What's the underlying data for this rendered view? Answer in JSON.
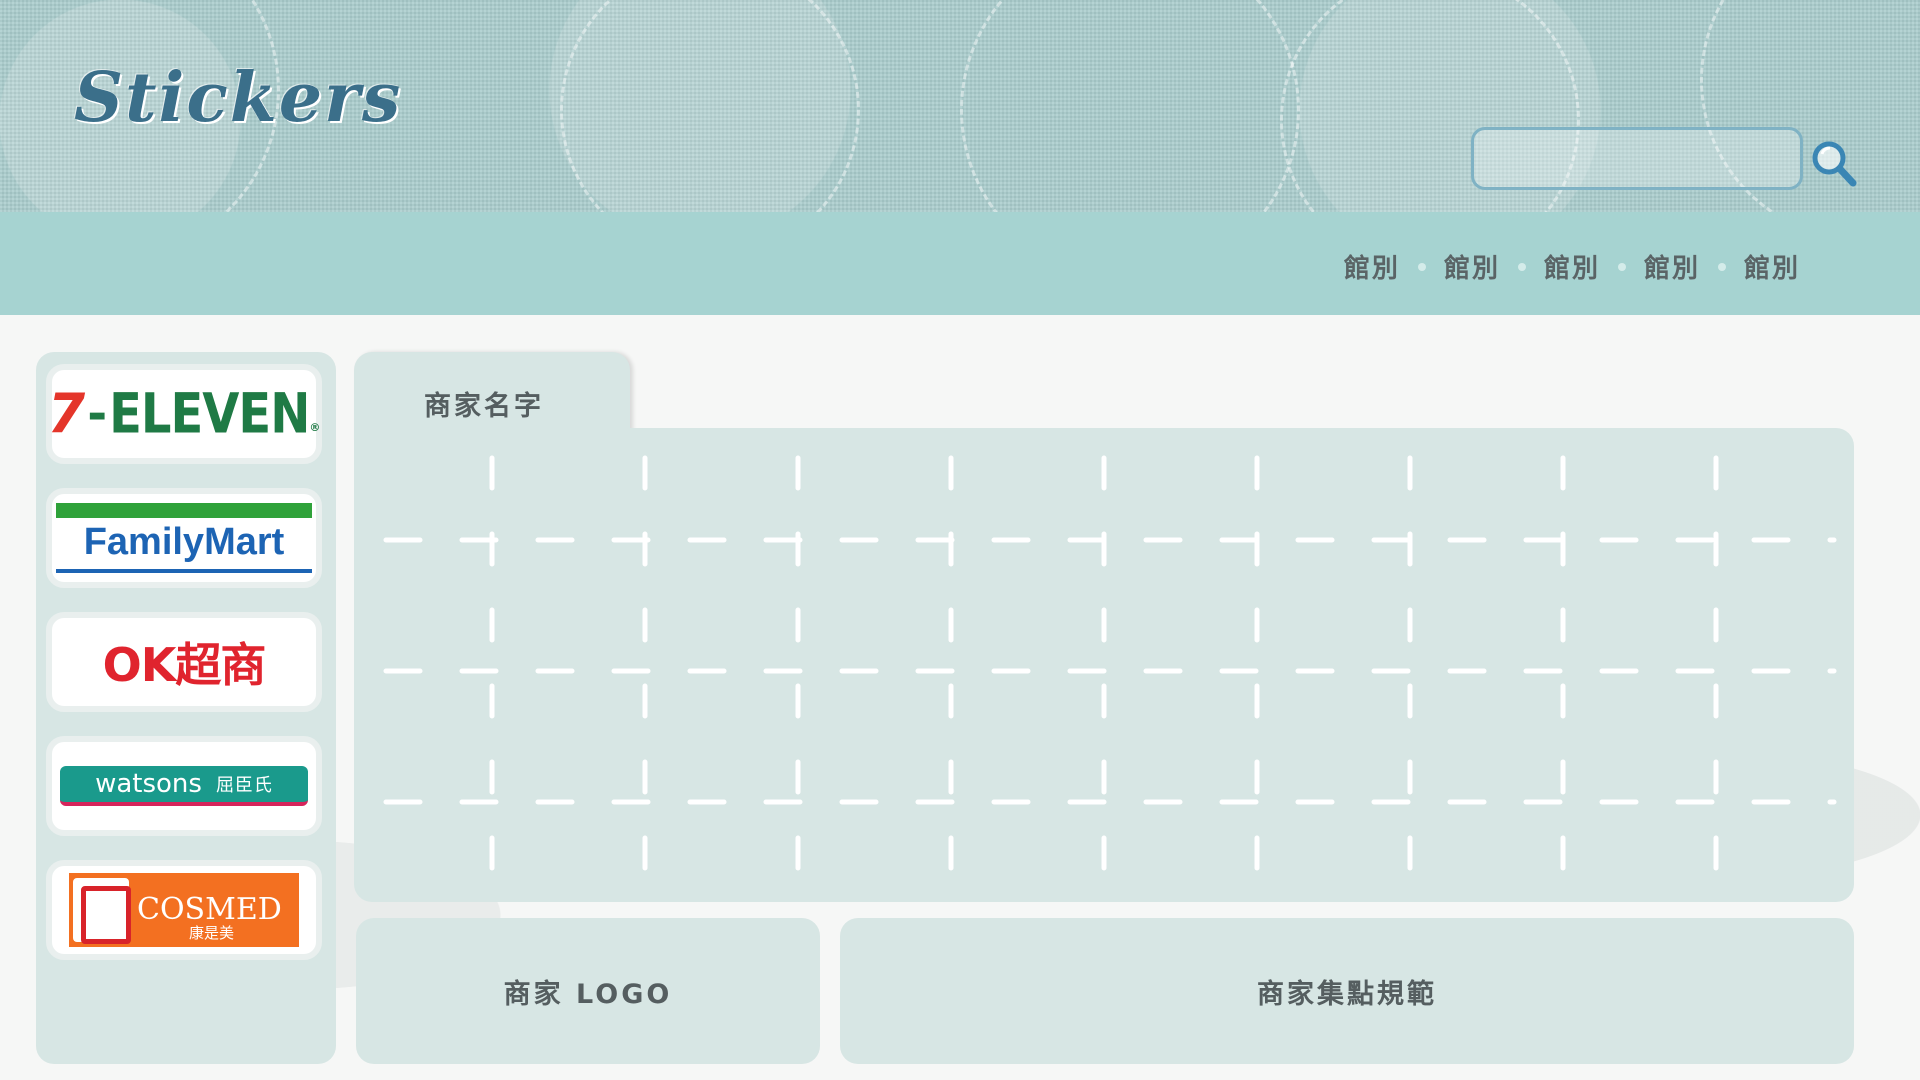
{
  "header": {
    "title": "Stickers",
    "search_placeholder": "",
    "search_icon": "magnifier-icon"
  },
  "nav": {
    "items": [
      {
        "label": "館別"
      },
      {
        "label": "館別"
      },
      {
        "label": "館別"
      },
      {
        "label": "館別"
      },
      {
        "label": "館別"
      }
    ]
  },
  "sidebar": {
    "brands": [
      {
        "name": "7-ELEVEN",
        "logo_parts": {
          "seven": "7",
          "dash": "-",
          "text": "ELEVEN",
          "reg": "®"
        }
      },
      {
        "name": "FamilyMart"
      },
      {
        "name": "OK超商"
      },
      {
        "name": "watsons",
        "cn": "屈臣氏"
      },
      {
        "name": "COSMED",
        "cn": "康是美"
      }
    ]
  },
  "panel": {
    "tab_label": "商家名字",
    "logo_box_label": "商家 LOGO",
    "rules_box_label": "商家集點規範"
  },
  "colors": {
    "header_bg": "#a9cccc",
    "nav_bg": "#a6d3d1",
    "panel_bg": "#d7e6e4",
    "title_color": "#3b6f8a",
    "label_color": "#555e60"
  }
}
